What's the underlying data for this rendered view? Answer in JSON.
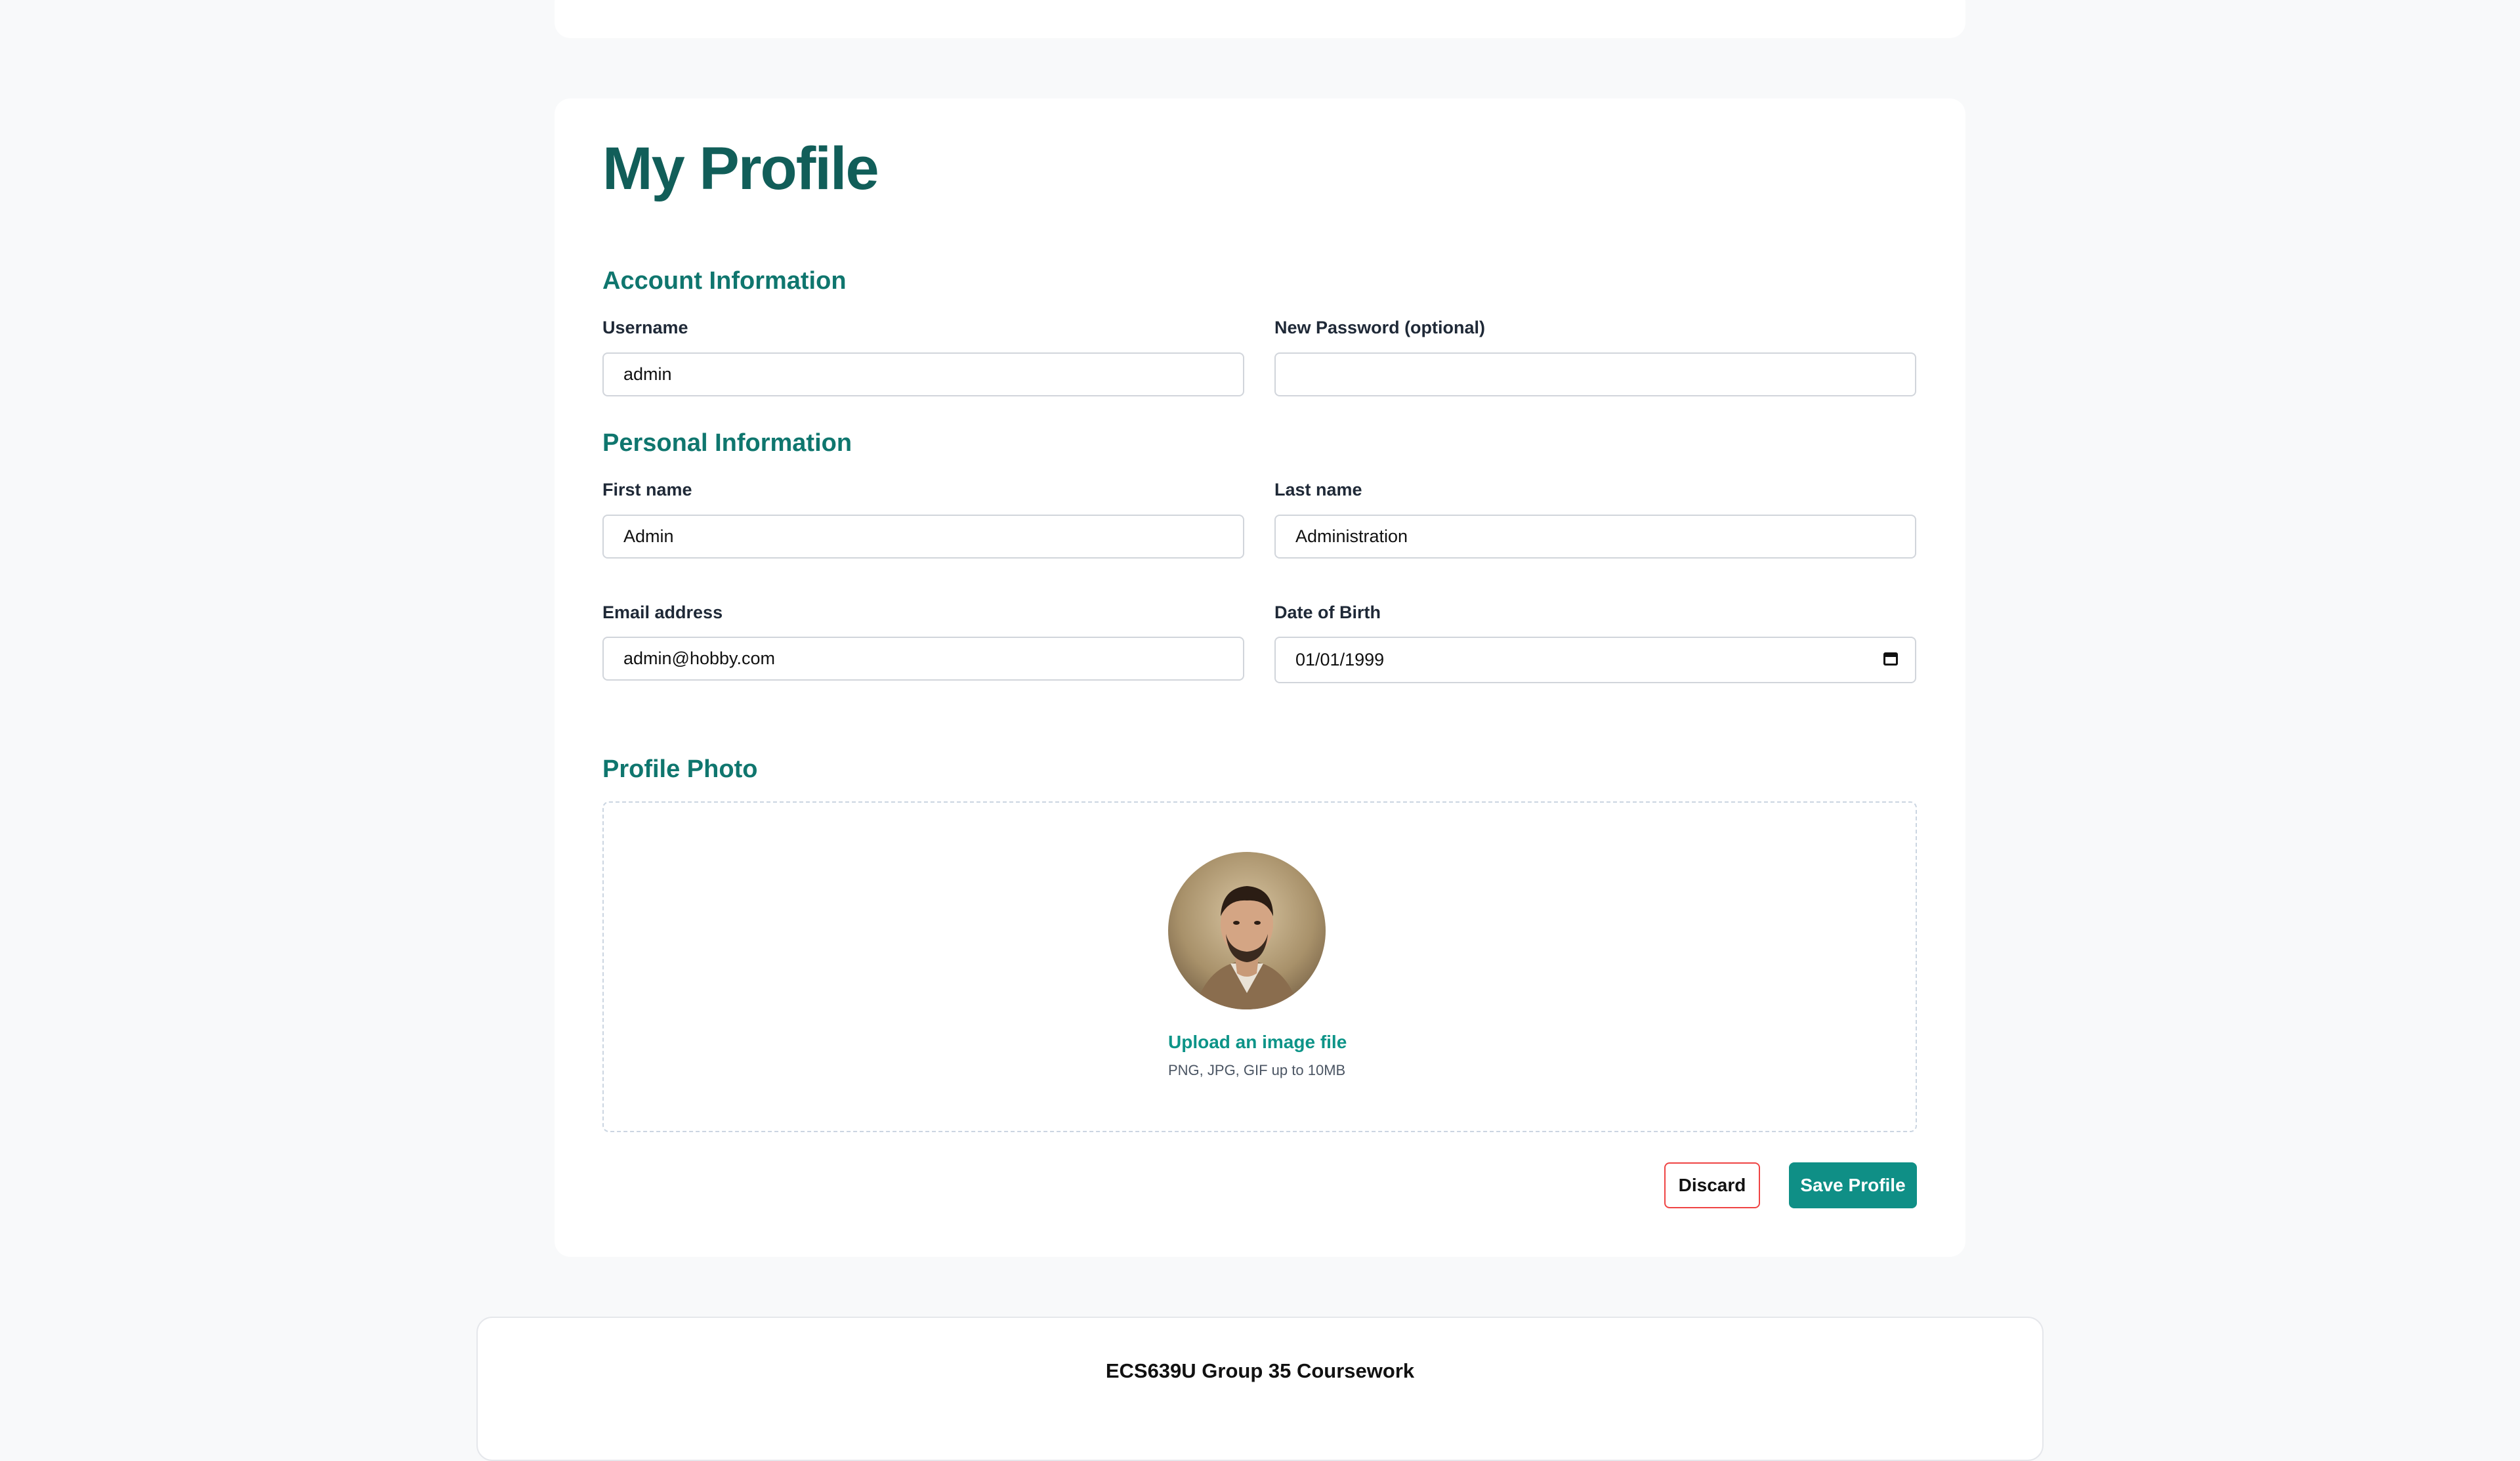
{
  "profile": {
    "title": "My Profile",
    "sections": {
      "account": "Account Information",
      "personal": "Personal Information",
      "photo": "Profile Photo"
    },
    "fields": {
      "username": {
        "label": "Username",
        "value": "admin"
      },
      "new_password": {
        "label": "New Password (optional)",
        "value": ""
      },
      "first_name": {
        "label": "First name",
        "value": "Admin"
      },
      "last_name": {
        "label": "Last name",
        "value": "Administration"
      },
      "email": {
        "label": "Email address",
        "value": "admin@hobby.com"
      },
      "dob": {
        "label": "Date of Birth",
        "value": "01/01/1999"
      }
    },
    "photo": {
      "upload_label": "Upload an image file",
      "hint": "PNG, JPG, GIF up to 10MB"
    },
    "buttons": {
      "discard": "Discard",
      "save": "Save Profile"
    }
  },
  "footer": {
    "text": "ECS639U Group 35 Coursework"
  },
  "colors": {
    "title": "#115e59",
    "accent": "#0f766e",
    "save_button": "#0f8f86",
    "discard_border": "#ef4444"
  }
}
